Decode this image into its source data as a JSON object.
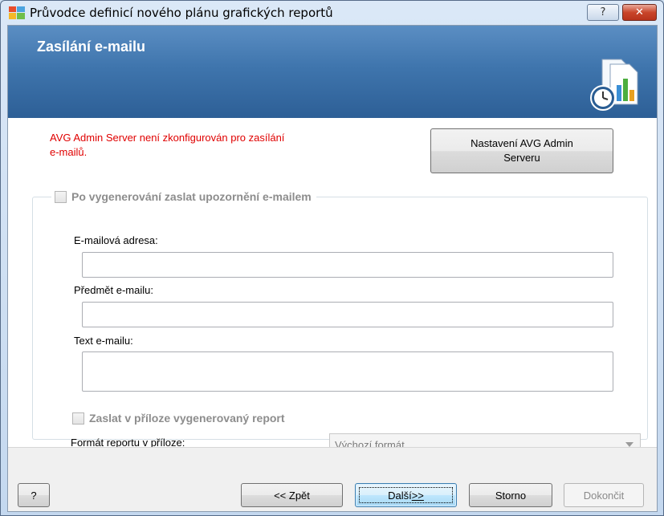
{
  "window": {
    "title": "Průvodce definicí nového plánu grafických reportů",
    "help_button": "?",
    "close_button": "✕"
  },
  "banner": {
    "title": "Zasílání e-mailu",
    "icon": "report-clock-icon"
  },
  "warning": {
    "line1": "AVG Admin Server není zkonfigurován pro zasílání",
    "line2": "e-mailů."
  },
  "settings_button": {
    "line1": "Nastavení AVG Admin",
    "line2": "Serveru"
  },
  "notify_group": {
    "checkbox_label": "Po vygenerování zaslat upozornění e-mailem",
    "checked": false,
    "email_label": "E-mailová adresa:",
    "email_value": "",
    "subject_label": "Předmět e-mailu:",
    "subject_value": "",
    "text_label": "Text e-mailu:",
    "text_value": "",
    "attach_label": "Zaslat v příloze vygenerovaný report",
    "attach_checked": false,
    "format_label": "Formát reportu v příloze:",
    "format_value": "Výchozí formát"
  },
  "footer": {
    "help": "?",
    "back": "<< Zpět",
    "next_prefix": "Další ",
    "next_suffix": ">>",
    "cancel": "Storno",
    "finish": "Dokončit"
  },
  "colors": {
    "warning": "#e00000",
    "banner": "#3f75ad",
    "disabled_text": "#8d8d8d"
  }
}
